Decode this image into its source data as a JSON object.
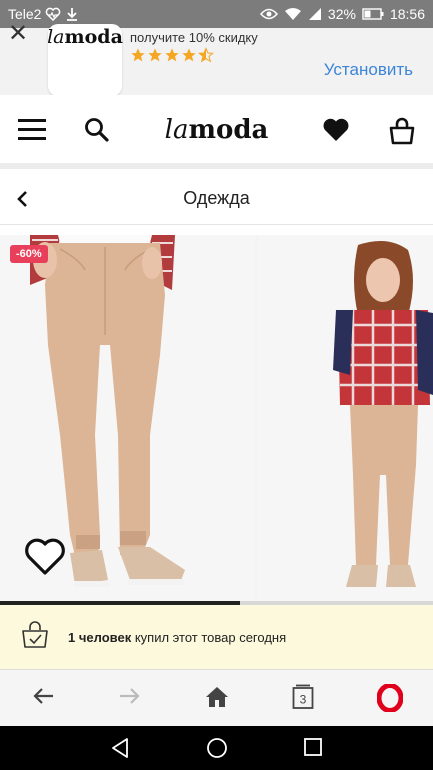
{
  "status_bar": {
    "carrier": "Tele2",
    "battery": "32%",
    "time": "18:56"
  },
  "app_banner": {
    "close_glyph": "✕",
    "app_name_light": "la",
    "app_name_bold": "moda",
    "promo_text": "получите 10% скидку",
    "rating_stars": 4.5,
    "install_label": "Установить"
  },
  "header": {
    "logo_light": "la",
    "logo_bold": "moda",
    "icons": [
      "menu-icon",
      "search-icon",
      "heart-icon",
      "cart-icon"
    ]
  },
  "subheader": {
    "title": "Одежда"
  },
  "product": {
    "discount_badge": "-60%",
    "gallery_progress": 0.555
  },
  "notice": {
    "count_text": "1 человек",
    "rest_text": " купил этот товар сегодня"
  },
  "browser_bar": {
    "tabs_count": "3",
    "icons": [
      "back-arrow-icon",
      "forward-arrow-icon",
      "home-icon",
      "tabs-icon",
      "opera-icon"
    ]
  },
  "colors": {
    "accent_blue": "#3d85d8",
    "discount_red": "#e8405a",
    "opera_red": "#e0001b",
    "star_gold": "#f5a623",
    "notice_bg": "#fdf9dc"
  }
}
